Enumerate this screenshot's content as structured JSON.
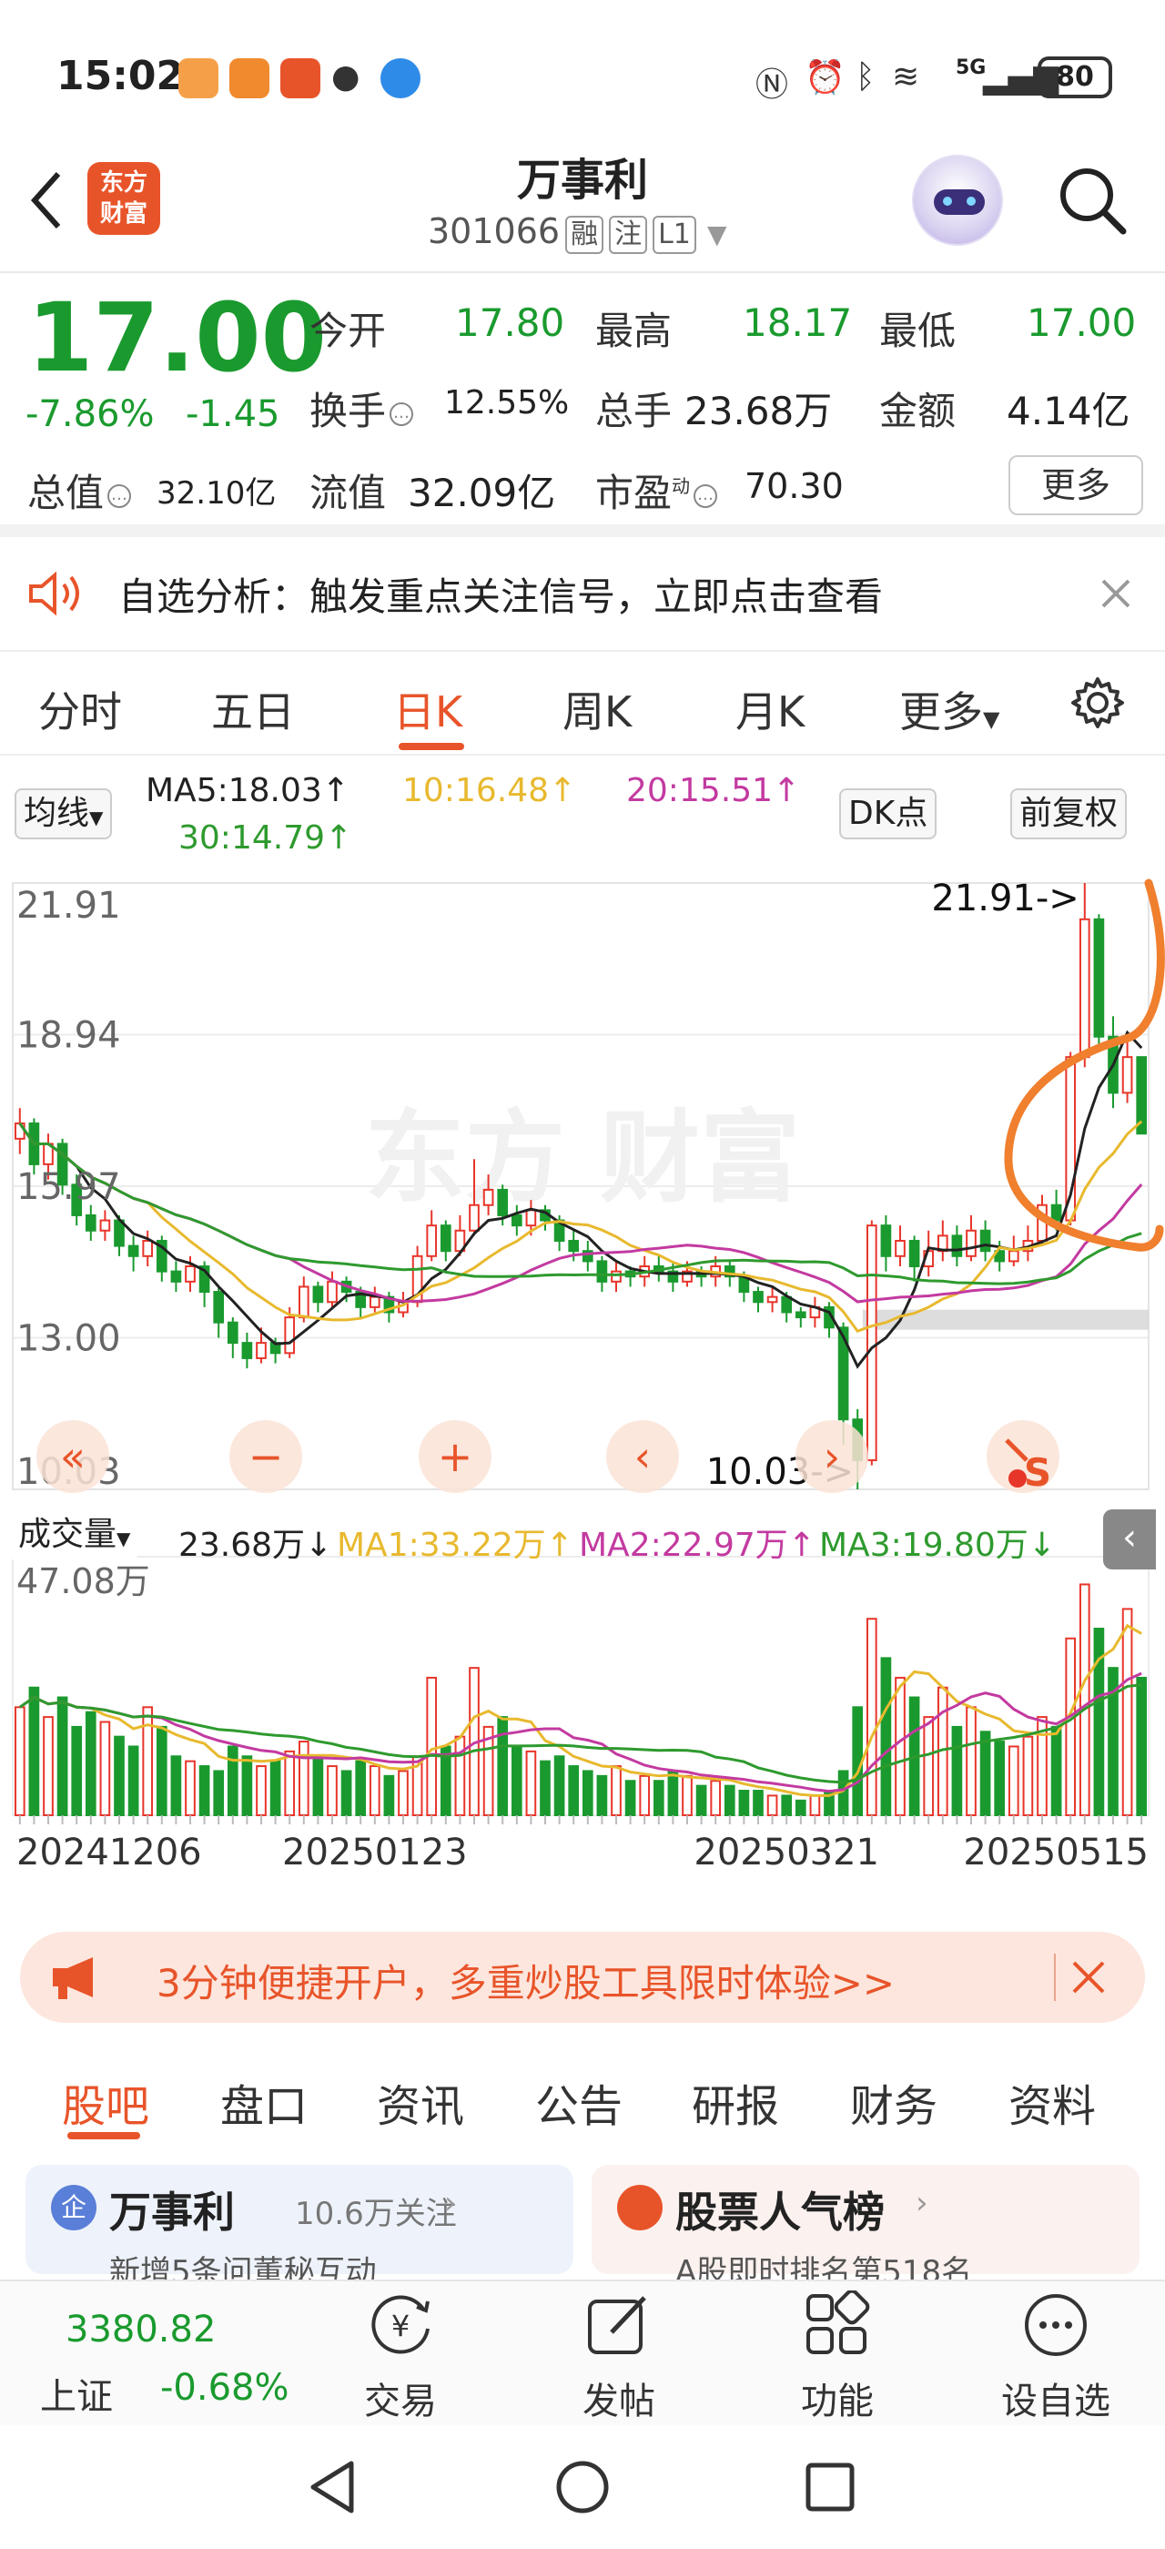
{
  "status_bar": {
    "time": "15:02",
    "network": "5G",
    "battery": "80"
  },
  "header": {
    "logo_text": "东方\n财富",
    "stock_name": "万事利",
    "stock_code": "301066",
    "tags": [
      "融",
      "注",
      "L1"
    ]
  },
  "quote": {
    "price": "17.00",
    "change_pct": "-7.86%",
    "change_amt": "-1.45",
    "open_label": "今开",
    "open": "17.80",
    "high_label": "最高",
    "high": "18.17",
    "low_label": "最低",
    "low": "17.00",
    "turnover_label": "换手",
    "turnover": "12.55%",
    "volume_label": "总手",
    "volume": "23.68万",
    "amount_label": "金额",
    "amount": "4.14亿",
    "mktcap_label": "总值",
    "mktcap": "32.10亿",
    "float_label": "流值",
    "float_cap": "32.09亿",
    "pe_label": "市盈",
    "pe_sup": "动",
    "pe": "70.30",
    "more": "更多"
  },
  "notice": {
    "text": "自选分析：触发重点关注信号，立即点击查看"
  },
  "chart_tabs": {
    "items": [
      "分时",
      "五日",
      "日K",
      "周K",
      "月K",
      "更多"
    ],
    "active": "日K"
  },
  "kline": {
    "indicator_select": "均线",
    "ma5": "MA5:18.03↑",
    "ma10": "10:16.48↑",
    "ma20": "20:15.51↑",
    "ma30": "30:14.79↑",
    "dk_btn": "DK点",
    "adjust_btn": "前复权",
    "y_top": "21.91",
    "y_2": "18.94",
    "y_3": "15.97",
    "y_4": "13.00",
    "y_bottom": "10.03",
    "max_marker": "21.91->",
    "min_marker": "10.03->",
    "colors": {
      "up": "#e8352a",
      "down": "#1a9a2e",
      "ma5": "#222222",
      "ma10": "#e8b92e",
      "ma20": "#c33aa0",
      "ma30": "#2e9a2e",
      "annotation": "#f07f2e"
    }
  },
  "chart_data": {
    "type": "candlestick",
    "ylim": [
      10.03,
      21.91
    ],
    "y_ticks": [
      21.91,
      18.94,
      15.97,
      13.0,
      10.03
    ],
    "candles": [
      [
        16.9,
        17.2,
        17.5,
        16.6
      ],
      [
        17.2,
        16.4,
        17.3,
        16.2
      ],
      [
        16.4,
        16.8,
        17.0,
        16.1
      ],
      [
        16.8,
        16.0,
        16.9,
        15.8
      ],
      [
        16.0,
        15.4,
        16.2,
        15.2
      ],
      [
        15.4,
        15.1,
        15.6,
        14.9
      ],
      [
        15.1,
        15.3,
        15.5,
        14.9
      ],
      [
        15.3,
        14.8,
        15.4,
        14.6
      ],
      [
        14.8,
        14.6,
        15.0,
        14.3
      ],
      [
        14.6,
        14.9,
        15.1,
        14.4
      ],
      [
        14.9,
        14.3,
        15.0,
        14.1
      ],
      [
        14.3,
        14.1,
        14.5,
        13.9
      ],
      [
        14.1,
        14.4,
        14.6,
        13.9
      ],
      [
        14.4,
        13.9,
        14.5,
        13.6
      ],
      [
        13.9,
        13.3,
        14.0,
        13.0
      ],
      [
        13.3,
        12.9,
        13.4,
        12.6
      ],
      [
        12.9,
        12.6,
        13.1,
        12.4
      ],
      [
        12.6,
        12.9,
        13.2,
        12.5
      ],
      [
        12.9,
        12.7,
        13.0,
        12.5
      ],
      [
        12.7,
        13.4,
        13.6,
        12.6
      ],
      [
        13.4,
        14.0,
        14.2,
        13.3
      ],
      [
        14.0,
        13.7,
        14.1,
        13.5
      ],
      [
        13.7,
        14.1,
        14.3,
        13.6
      ],
      [
        14.1,
        13.9,
        14.2,
        13.7
      ],
      [
        13.9,
        13.6,
        14.0,
        13.4
      ],
      [
        13.6,
        13.8,
        14.0,
        13.5
      ],
      [
        13.8,
        13.5,
        13.9,
        13.3
      ],
      [
        13.5,
        13.7,
        13.9,
        13.4
      ],
      [
        13.7,
        14.6,
        14.8,
        13.6
      ],
      [
        14.6,
        15.2,
        15.5,
        14.5
      ],
      [
        15.2,
        14.7,
        15.3,
        14.5
      ],
      [
        14.7,
        15.1,
        15.4,
        14.6
      ],
      [
        15.1,
        15.6,
        16.5,
        15.0
      ],
      [
        15.6,
        15.9,
        16.2,
        15.4
      ],
      [
        15.9,
        15.4,
        16.0,
        15.2
      ],
      [
        15.4,
        15.2,
        15.6,
        15.0
      ],
      [
        15.2,
        15.5,
        15.7,
        15.0
      ],
      [
        15.5,
        15.3,
        15.6,
        15.1
      ],
      [
        15.3,
        14.9,
        15.4,
        14.7
      ],
      [
        14.9,
        14.7,
        15.1,
        14.5
      ],
      [
        14.7,
        14.5,
        14.9,
        14.3
      ],
      [
        14.5,
        14.1,
        14.6,
        13.9
      ],
      [
        14.1,
        14.3,
        14.5,
        13.9
      ],
      [
        14.3,
        14.2,
        14.4,
        14.0
      ],
      [
        14.2,
        14.4,
        14.6,
        14.0
      ],
      [
        14.4,
        14.3,
        14.6,
        14.1
      ],
      [
        14.3,
        14.1,
        14.5,
        13.9
      ],
      [
        14.1,
        14.3,
        14.5,
        14.0
      ],
      [
        14.3,
        14.2,
        14.4,
        14.0
      ],
      [
        14.2,
        14.4,
        14.6,
        14.0
      ],
      [
        14.4,
        14.2,
        14.5,
        14.0
      ],
      [
        14.2,
        13.9,
        14.3,
        13.7
      ],
      [
        13.9,
        13.7,
        14.0,
        13.5
      ],
      [
        13.7,
        13.8,
        14.0,
        13.5
      ],
      [
        13.8,
        13.5,
        13.9,
        13.3
      ],
      [
        13.5,
        13.4,
        13.6,
        13.2
      ],
      [
        13.4,
        13.6,
        13.8,
        13.2
      ],
      [
        13.6,
        13.2,
        13.7,
        13.0
      ],
      [
        13.2,
        11.4,
        13.3,
        10.9
      ],
      [
        11.4,
        10.6,
        11.6,
        10.03
      ],
      [
        10.6,
        15.2,
        15.3,
        10.5
      ],
      [
        15.2,
        14.6,
        15.4,
        14.3
      ],
      [
        14.6,
        14.9,
        15.2,
        14.4
      ],
      [
        14.9,
        14.4,
        15.0,
        14.1
      ],
      [
        14.4,
        14.7,
        15.1,
        14.2
      ],
      [
        14.7,
        15.0,
        15.3,
        14.5
      ],
      [
        15.0,
        14.6,
        15.2,
        14.4
      ],
      [
        14.6,
        15.1,
        15.4,
        14.5
      ],
      [
        15.1,
        14.7,
        15.3,
        14.5
      ],
      [
        14.7,
        14.5,
        14.9,
        14.3
      ],
      [
        14.5,
        14.7,
        15.0,
        14.4
      ],
      [
        14.7,
        14.9,
        15.2,
        14.5
      ],
      [
        14.9,
        15.6,
        15.8,
        14.8
      ],
      [
        15.6,
        15.3,
        15.9,
        15.1
      ],
      [
        15.3,
        18.5,
        18.6,
        15.2
      ],
      [
        18.5,
        21.2,
        21.91,
        18.3
      ],
      [
        21.2,
        18.9,
        21.3,
        18.6
      ],
      [
        18.9,
        17.8,
        19.3,
        17.5
      ],
      [
        17.8,
        18.5,
        18.9,
        17.6
      ],
      [
        18.5,
        17.0,
        18.2,
        17.0
      ]
    ],
    "volume": {
      "label": "成交量",
      "current": "23.68万↓",
      "ma1": "MA1:33.22万↑",
      "ma2": "MA2:22.97万↑",
      "ma3": "MA3:19.80万↓",
      "y_max_label": "47.08万",
      "ylim": [
        0,
        47.08
      ],
      "values": [
        22,
        26,
        20,
        24,
        18,
        21,
        19,
        16,
        14,
        22,
        18,
        12,
        11,
        10,
        9,
        14,
        12,
        10,
        11,
        13,
        15,
        12,
        10,
        9,
        11,
        10,
        8,
        9,
        12,
        28,
        14,
        16,
        30,
        18,
        20,
        14,
        13,
        11,
        12,
        10,
        9,
        8,
        10,
        7,
        8,
        7,
        9,
        8,
        6,
        7,
        6,
        5,
        5,
        4,
        4,
        3,
        4,
        5,
        9,
        22,
        40,
        32,
        28,
        24,
        20,
        26,
        18,
        22,
        17,
        15,
        14,
        16,
        20,
        18,
        36,
        47,
        38,
        30,
        42,
        28
      ]
    },
    "x_labels": [
      "20241206",
      "20250123",
      "20250321",
      "20250515"
    ]
  },
  "banner": {
    "text": "3分钟便捷开户，多重炒股工具限时体验>>"
  },
  "bottom_tabs": {
    "items": [
      "股吧",
      "盘口",
      "资讯",
      "公告",
      "研报",
      "财务",
      "资料"
    ],
    "active": "股吧"
  },
  "cards": {
    "left_title": "万事利",
    "left_sub": "10.6万关注",
    "left_line": "新增5条问董秘互动",
    "right_title": "股票人气榜",
    "right_line": "A股即时排名第518名"
  },
  "bottom_nav": {
    "index_value": "3380.82",
    "index_name": "上证",
    "index_change": "-0.68%",
    "trade": "交易",
    "post": "发帖",
    "function": "功能",
    "add_watch": "设自选"
  }
}
